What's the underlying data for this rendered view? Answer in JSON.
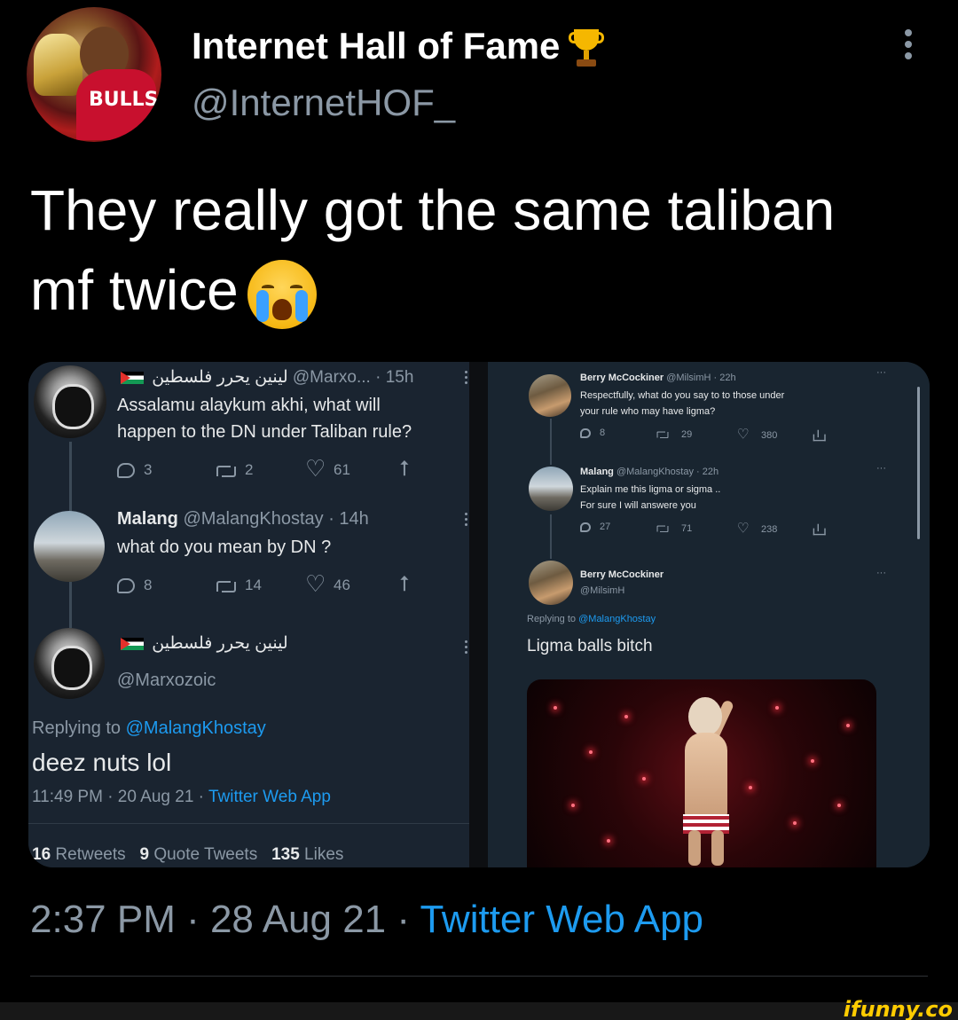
{
  "header": {
    "name": "Internet Hall of Fame",
    "handle": "@InternetHOF_",
    "trophy_icon": "trophy-emoji"
  },
  "tweet": {
    "text_line1": "They really got the same taliban",
    "text_line2": "mf twice",
    "emoji": "loudly-crying-face"
  },
  "left_thread": {
    "tweet1": {
      "name": "لينين يحرر فلسطين",
      "handle_time": "@Marxo... · 15h",
      "text_line1": "Assalamu alaykum akhi, what will",
      "text_line2": "happen to the DN under Taliban rule?",
      "replies": "3",
      "retweets": "2",
      "likes": "61"
    },
    "tweet2": {
      "name": "Malang",
      "handle_time": "@MalangKhostay · 14h",
      "text": "what do you mean by DN ?",
      "replies": "8",
      "retweets": "14",
      "likes": "46"
    },
    "tweet3": {
      "name": "لينين يحرر فلسطين",
      "handle": "@Marxozoic",
      "replying_prefix": "Replying to",
      "replying_to": "@MalangKhostay",
      "text": "deez nuts lol",
      "meta_prefix": "11:49 PM · 20 Aug 21 · ",
      "meta_app": "Twitter Web App",
      "retweets_count": "16",
      "retweets_label": "Retweets",
      "quotes_count": "9",
      "quotes_label": "Quote Tweets",
      "likes_count": "135",
      "likes_label": "Likes"
    }
  },
  "right_thread": {
    "tweet1": {
      "name": "Berry McCockiner",
      "handle_time": "@MilsimH · 22h",
      "text_line1": "Respectfully, what do you say to to those under",
      "text_line2": "your rule who may have ligma?",
      "replies": "8",
      "retweets": "29",
      "likes": "380"
    },
    "tweet2": {
      "name": "Malang",
      "handle_time": "@MalangKhostay · 22h",
      "text_line1": "Explain me this ligma or sigma ..",
      "text_line2": "For sure I will answere you",
      "replies": "27",
      "retweets": "71",
      "likes": "238"
    },
    "tweet3": {
      "name": "Berry McCockiner",
      "handle": "@MilsimH",
      "replying_prefix": "Replying to",
      "replying_to": "@MalangKhostay",
      "text": "Ligma balls bitch"
    }
  },
  "footer": {
    "time": "2:37 PM · 28 Aug 21 · ",
    "app": "Twitter Web App",
    "watermark": "ifunny.co"
  },
  "colors": {
    "background": "#000000",
    "accent_blue": "#1d9bf0",
    "dim_text": "#8b98a5",
    "panel": "#15202b"
  }
}
